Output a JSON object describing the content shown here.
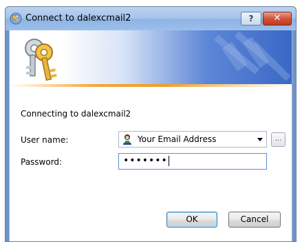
{
  "window": {
    "title": "Connect to dalexcmail2",
    "help_label": "?",
    "close_label": "✕"
  },
  "dialog": {
    "connecting_text": "Connecting to dalexcmail2",
    "username_label": "User name:",
    "username_value": "Your Email Address",
    "browse_label": "...",
    "password_label": "Password:",
    "password_masked": "•••••••",
    "ok_label": "OK",
    "cancel_label": "Cancel"
  },
  "icons": {
    "title": "keys-icon",
    "banner": "keys-icon",
    "user": "user-icon",
    "dropdown": "chevron-down-icon"
  },
  "colors": {
    "titlebar": "#a7c5ec",
    "banner_blue": "#3a68c6",
    "accent_orange": "#f39c23",
    "close_red": "#c13a1f"
  }
}
